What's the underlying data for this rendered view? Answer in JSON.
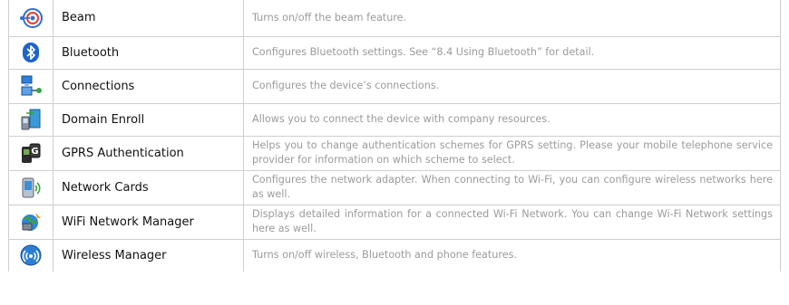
{
  "rows": [
    {
      "icon": "beam-icon",
      "name": "Beam",
      "description": "Turns on/off the beam feature."
    },
    {
      "icon": "bluetooth-icon",
      "name": "Bluetooth",
      "description": "Configures Bluetooth settings. See “8.4 Using Bluetooth” for detail."
    },
    {
      "icon": "connections-icon",
      "name": "Connections",
      "description": "Configures the device’s connections."
    },
    {
      "icon": "domain-enroll-icon",
      "name": "Domain Enroll",
      "description": "Allows you to connect the device with company resources."
    },
    {
      "icon": "gprs-authentication-icon",
      "name": "GPRS Authentication",
      "description": "Helps you to change authentication schemes for GPRS setting. Please your mobile telephone service provider for information on which scheme to select."
    },
    {
      "icon": "network-cards-icon",
      "name": "Network Cards",
      "description": "Configures the network adapter. When connecting to Wi-Fi, you can configure wireless networks here as well."
    },
    {
      "icon": "wifi-network-manager-icon",
      "name": "WiFi Network Manager",
      "description": "Displays detailed information for a connected Wi-Fi Network. You can change Wi-Fi Network settings here as well."
    },
    {
      "icon": "wireless-manager-icon",
      "name": "Wireless Manager",
      "description": "Turns on/off wireless, Bluetooth and phone features."
    }
  ]
}
